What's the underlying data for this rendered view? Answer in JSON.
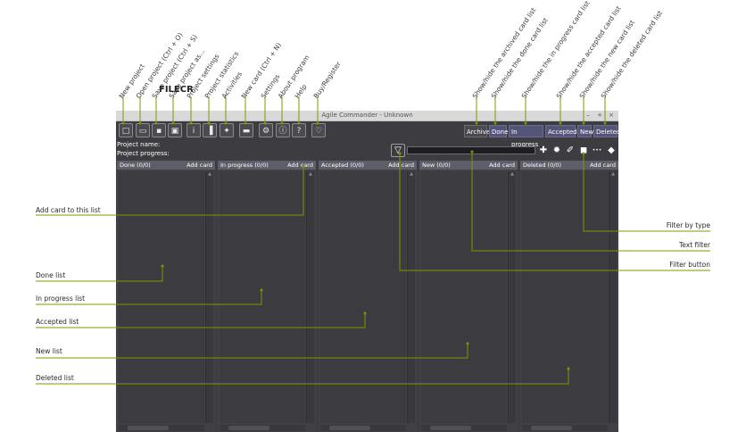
{
  "window": {
    "title": "Agile Commander - Unknown",
    "controls": [
      "–",
      "+",
      "×"
    ]
  },
  "watermark": "FILECR",
  "toolbar": {
    "buttons": [
      {
        "icon": "new-file-icon",
        "glyph": "□"
      },
      {
        "icon": "open-folder-icon",
        "glyph": "▭"
      },
      {
        "icon": "save-icon",
        "glyph": "▪"
      },
      {
        "icon": "save-as-icon",
        "glyph": "▣"
      },
      {
        "icon": "settings-icon",
        "glyph": "i"
      },
      {
        "icon": "statistics-icon",
        "glyph": "▐"
      },
      {
        "icon": "activities-icon",
        "glyph": "✦"
      },
      {
        "icon": "new-card-icon",
        "glyph": "▬"
      },
      {
        "icon": "settings-gear-icon",
        "glyph": "⚙"
      },
      {
        "icon": "about-icon",
        "glyph": "ⓘ"
      },
      {
        "icon": "help-icon",
        "glyph": "?"
      },
      {
        "icon": "buy-register-icon",
        "glyph": "♡"
      }
    ],
    "toggles": [
      "Archive",
      "Done",
      "In progress",
      "Accepted",
      "New",
      "Deleted"
    ]
  },
  "info": {
    "project_name_label": "Project name:",
    "project_progress_label": "Project progress:"
  },
  "filters": {
    "filter_button_glyph": "▽",
    "type_buttons": [
      {
        "icon": "plus-icon",
        "glyph": "✚"
      },
      {
        "icon": "bug-icon",
        "glyph": "✹"
      },
      {
        "icon": "wrench-icon",
        "glyph": "✐"
      },
      {
        "icon": "square-icon",
        "glyph": "◼"
      },
      {
        "icon": "ellipsis-icon",
        "glyph": "•••"
      },
      {
        "icon": "diamond-icon",
        "glyph": "◆"
      }
    ]
  },
  "lists": [
    {
      "title": "Done (0/0)",
      "add": "Add card"
    },
    {
      "title": "In progress (0/0)",
      "add": "Add card"
    },
    {
      "title": "Accepted (0/0)",
      "add": "Add card"
    },
    {
      "title": "New (0/0)",
      "add": "Add card"
    },
    {
      "title": "Deleted (0/0)",
      "add": "Add card"
    }
  ],
  "annotations": {
    "top": [
      "New project",
      "Open project (Ctrl + O)",
      "Save project (Ctrl + S)",
      "Save project as...",
      "Project settings",
      "Project statistics",
      "Activities",
      "New card (Ctrl + N)",
      "Settings",
      "About program",
      "Help",
      "Buy/Register"
    ],
    "top_right": [
      "Show/hide the archived card list",
      "Show/hide the done card list",
      "Show/hide the in progress card list",
      "Show/hide the accepted card list",
      "Show/hide the new card list",
      "Show/hide the deleted card list"
    ],
    "left": [
      "Add card to this list",
      "Done list",
      "In progress list",
      "Accepted list",
      "New list",
      "Deleted list"
    ],
    "right": [
      "Filter by type",
      "Text filter",
      "Filter button"
    ]
  },
  "colors": {
    "callout": "#7a9a00",
    "window_bg": "#3c3c41",
    "list_header": "#5e5e6a",
    "toggle_on": "#55557a"
  }
}
